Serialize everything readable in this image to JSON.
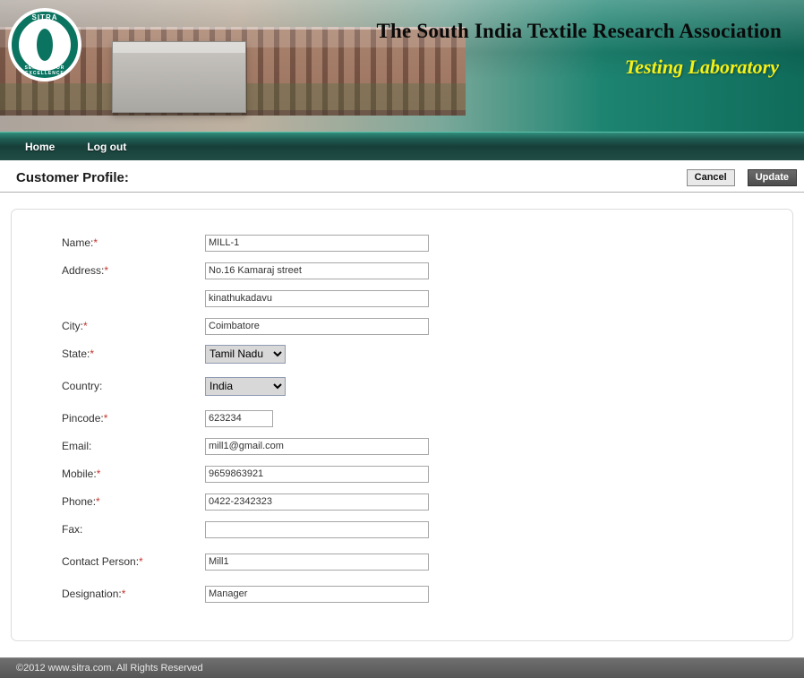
{
  "banner": {
    "logo_top": "SITRA",
    "logo_bottom": "SERVICE FOR EXCELLENCE",
    "title": "The South India Textile Research Association",
    "subtitle": "Testing Laboratory"
  },
  "nav": {
    "home": "Home",
    "logout": "Log out"
  },
  "page": {
    "title": "Customer Profile:",
    "cancel": "Cancel",
    "update": "Update"
  },
  "form": {
    "labels": {
      "name": "Name:",
      "address": "Address:",
      "city": "City:",
      "state": "State:",
      "country": "Country:",
      "pincode": "Pincode:",
      "email": "Email:",
      "mobile": "Mobile:",
      "phone": "Phone:",
      "fax": "Fax:",
      "contact": "Contact Person:",
      "designation": "Designation:"
    },
    "values": {
      "name": "MILL-1",
      "address1": "No.16 Kamaraj street",
      "address2": "kinathukadavu",
      "city": "Coimbatore",
      "state": "Tamil Nadu",
      "country": "India",
      "pincode": "623234",
      "email": "mill1@gmail.com",
      "mobile": "9659863921",
      "phone": "0422-2342323",
      "fax": "",
      "contact": "Mill1",
      "designation": "Manager"
    }
  },
  "footer": {
    "text": "©2012 www.sitra.com. All Rights Reserved"
  }
}
